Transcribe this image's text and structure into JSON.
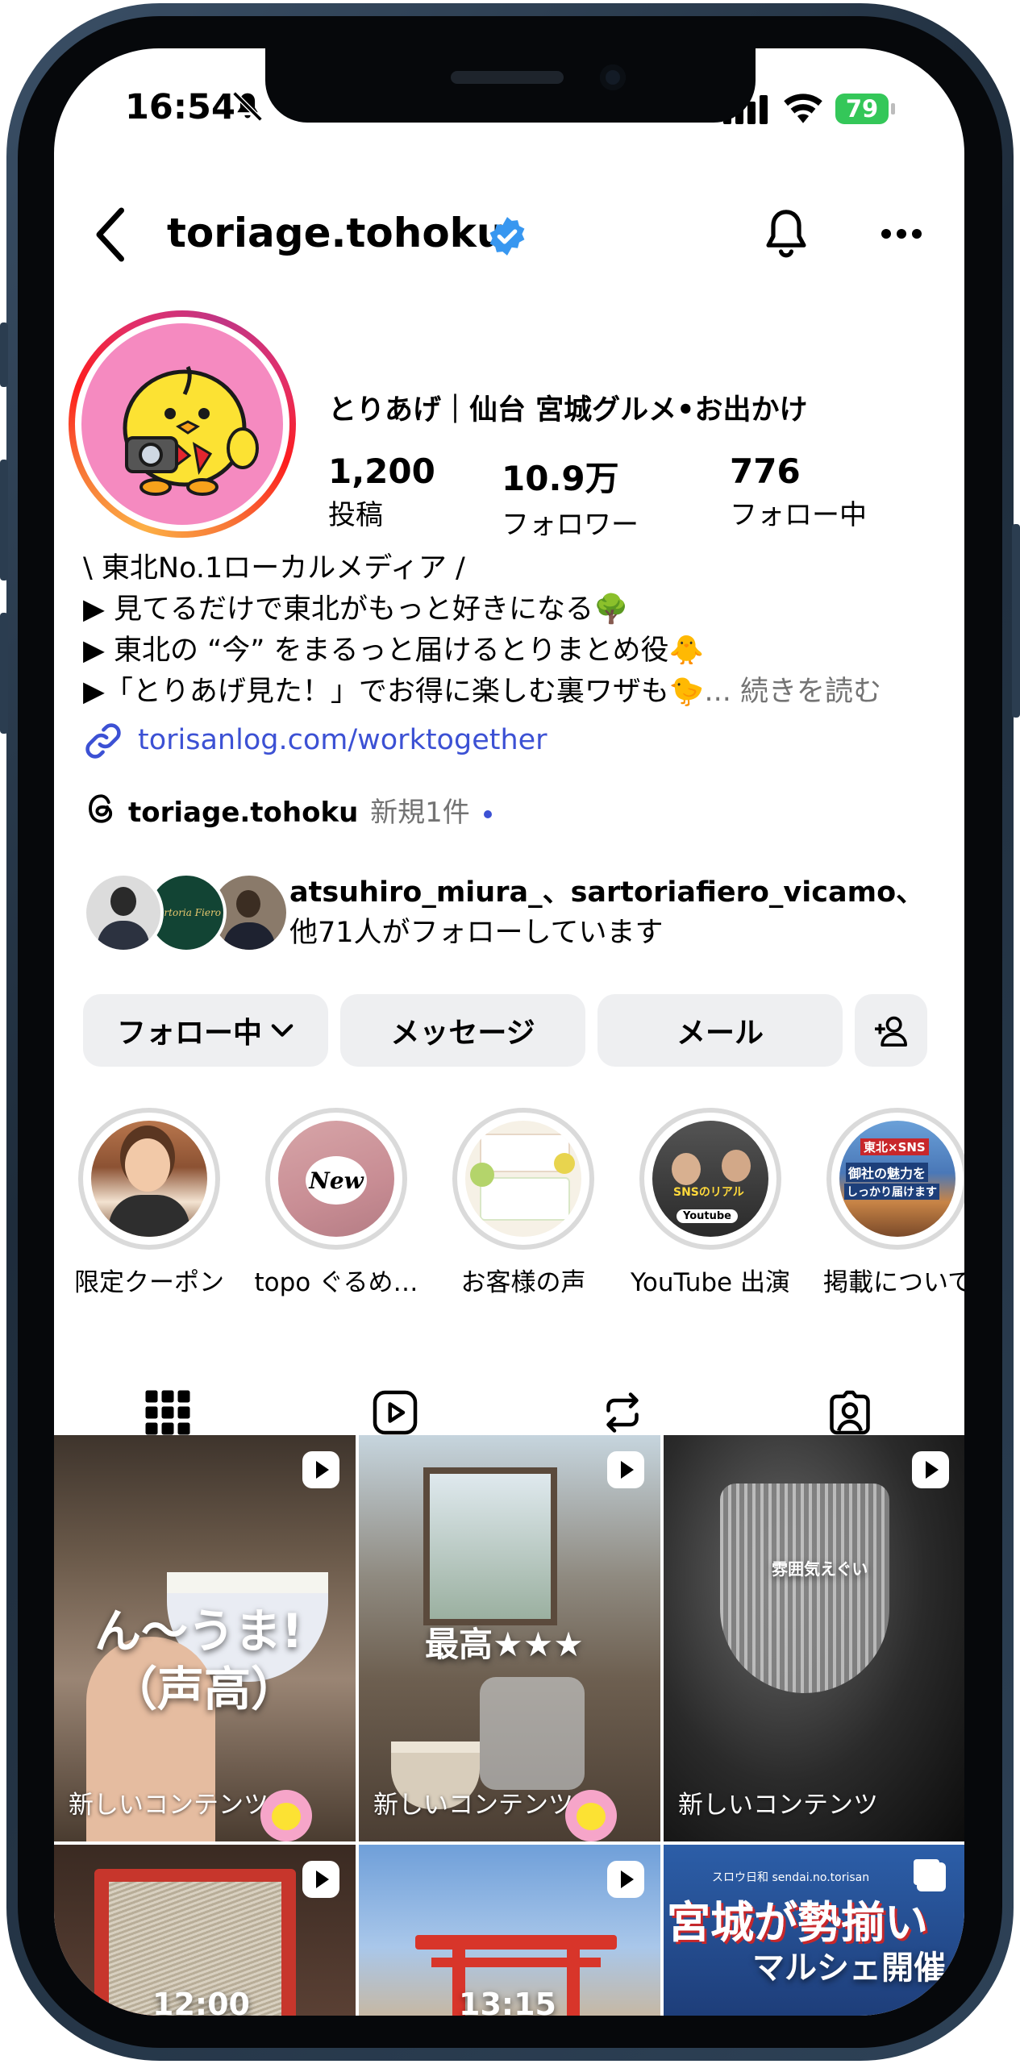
{
  "status_bar": {
    "time": "16:54",
    "battery": "79"
  },
  "header": {
    "username": "toriage.tohoku"
  },
  "profile": {
    "display_name": "とりあげ｜仙台 宮城グルメ•お出かけ",
    "stats": [
      {
        "value": "1,200",
        "label": "投稿"
      },
      {
        "value": "10.9万",
        "label": "フォロワー"
      },
      {
        "value": "776",
        "label": "フォロー中"
      }
    ],
    "bio_lines": [
      "\\ 東北No.1ローカルメディア /",
      "▶ 見てるだけで東北がもっと好きになる🌳",
      "▶ 東北の “今” をまるっと届けるとりまとめ役🐥",
      "▶「とりあげ見た！」でお得に楽しむ裏ワザも🐤"
    ],
    "bio_more": "... 続きを読む",
    "link": "torisanlog.com/worktogether",
    "threads_handle": "toriage.tohoku",
    "threads_new": "新規1件",
    "followed_by_line1": "atsuhiro_miura_、sartoriafiero_vicamo、",
    "followed_by_line2": "他71人がフォローしています",
    "mutual_avatar_text": "Sartoria Fiero"
  },
  "actions": {
    "following": "フォロー中",
    "message": "メッセージ",
    "email": "メール"
  },
  "highlights": [
    {
      "label": "限定クーポン"
    },
    {
      "label": "topo ぐるめ…",
      "badge": "New"
    },
    {
      "label": "お客様の声"
    },
    {
      "label": "YouTube 出演",
      "badge": "Youtube",
      "overlay": "SNSのリアル"
    },
    {
      "label": "掲載について",
      "overlay_line1": "東北×SNS",
      "overlay_line2": "御社の魅力を",
      "overlay_line3": "しっかり届けます"
    }
  ],
  "grid": [
    {
      "caption": "新しいコンテンツ",
      "overlay_line1": "ん〜うま!",
      "overlay_line2": "（声高）"
    },
    {
      "caption": "新しいコンテンツ",
      "overlay": "最高★★★"
    },
    {
      "caption": "新しいコンテンツ",
      "overlay": "雰囲気えぐい"
    },
    {
      "time": "12:00"
    },
    {
      "time": "13:15"
    },
    {
      "overlay_small": "スロウ日和 sendai.no.torisan",
      "overlay_big1": "宮城が勢揃い",
      "overlay_big2": "マルシェ開催"
    }
  ],
  "colors": {
    "accent_link": "#3c51d4",
    "verified": "#3897f0",
    "battery": "#34c759",
    "avatar_bg": "#f58ac0"
  }
}
